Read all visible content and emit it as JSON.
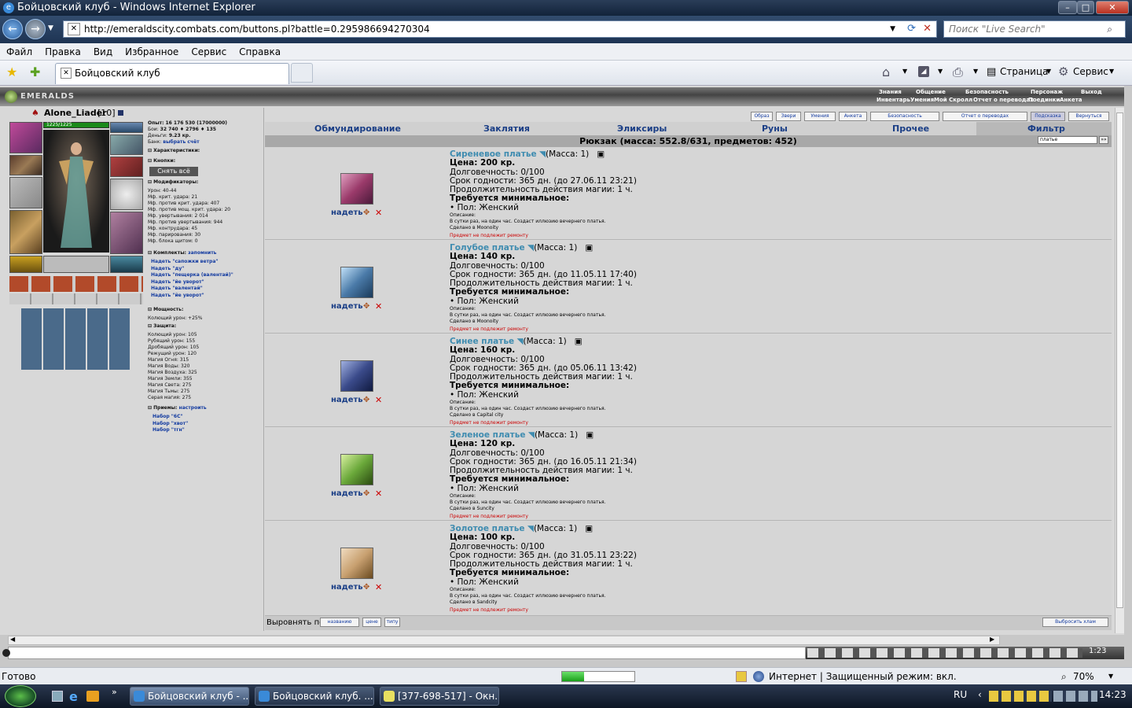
{
  "window": {
    "title": "Бойцовский клуб - Windows Internet Explorer"
  },
  "browser": {
    "url": "http://emeraldscity.combats.com/buttons.pl?battle=0.295986694270304",
    "search_placeholder": "Поиск \"Live Search\"",
    "menu": [
      "Файл",
      "Правка",
      "Вид",
      "Избранное",
      "Сервис",
      "Справка"
    ],
    "tab_title": "Бойцовский клуб",
    "toolbar": {
      "page": "Страница",
      "tools": "Сервис"
    }
  },
  "game": {
    "logo": "EMERALDS",
    "top_links_row1": [
      "Знания",
      "Общение",
      "Безопасность",
      "Персонаж",
      "Выход"
    ],
    "top_links_row2": [
      "Инвентарь",
      "Умения",
      "Мой Скролл",
      "Отчет о переводах",
      "Поединки",
      "Анкета"
    ],
    "right_buttons": [
      "Образ",
      "Звери",
      "Умения",
      "Анкета",
      "Безопасность",
      "Отчет о переводах",
      "Подсказка",
      "Вернуться"
    ],
    "character": {
      "name": "Alone_Liader",
      "level": "[10]",
      "hp": "1225/1225",
      "stats": [
        [
          "Опыт:",
          "16 176 530 (17000000)"
        ],
        [
          "Бои:",
          "32 740 ♦ 2796 ♦ 135"
        ],
        [
          "Деньги:",
          "9.23 кр."
        ],
        [
          "Банк:",
          "выбрать счёт"
        ]
      ],
      "sections": [
        "Характеристики:",
        "Кнопки:",
        "Модификаторы:",
        "Комплекты:",
        "Мощность:",
        "Защита:",
        "Приемы:"
      ],
      "remove_all": "Снять всё",
      "modifiers": [
        "Урон: 40-44",
        "Мф. крит. удара: 21",
        "Мф. против крит. удара: 407",
        "Мф. против мощ. крит. удара: 20",
        "Мф. увертывания: 2 014",
        "Мф. против увертывания: 944",
        "Мф. контрудара: 45",
        "Мф. парирования: 30",
        "Мф. блока щитом: 0"
      ],
      "sets_link": "запомнить",
      "sets": [
        "Надеть \"сапожки ветра\"",
        "Надеть \"ду\"",
        "Надеть \"пещерка (валентай)\"",
        "Надеть \"йе уворот\"",
        "Надеть \"валентай\"",
        "Надеть \"йе уворот\""
      ],
      "power": [
        "Колющий урон: +25%"
      ],
      "defense": [
        "Колющий урон: 105",
        "Рубящий урон: 155",
        "Дробящий урон: 105",
        "Режущий урон: 120",
        "Магия Огня: 315",
        "Магия Воды: 320",
        "Магия Воздуха: 325",
        "Магия Земли: 355",
        "Магия Света: 275",
        "Магия Тьмы: 275",
        "Серая магия: 275"
      ],
      "techniques_link": "настроить",
      "techniques": [
        "Набор \"6С\"",
        "Набор \"хвот\"",
        "Набор \"тгн\""
      ]
    },
    "inventory_tabs": [
      "Обмундирование",
      "Заклятия",
      "Эликсиры",
      "Руны",
      "Прочее",
      "Фильтр"
    ],
    "filter_value": "платье",
    "filter_button": "»»",
    "backpack": "Рюкзак (масса: 552.8/631, предметов: 452)",
    "wear_label": "надеть",
    "items": [
      {
        "name": "Сиреневое платье",
        "mass": "(Масса: 1)",
        "price": "Цена: 200 кр.",
        "durability": "Долговечность: 0/100",
        "expiry": "Срок годности: 365 дн. (до 27.06.11 23:21)",
        "duration": "Продолжительность действия магии: 1 ч.",
        "req": "Требуется минимальное:",
        "gender": "• Пол: Женский",
        "desc_label": "Описание:",
        "desc": "В сутки раз, на один час. Создаст иллюзию вечернего платья.",
        "made": "Сделано в Moonoity",
        "repair": "Предмет не подлежит ремонту",
        "color": "#9a3a6a"
      },
      {
        "name": "Голубое платье",
        "mass": "(Масса: 1)",
        "price": "Цена: 140 кр.",
        "durability": "Долговечность: 0/100",
        "expiry": "Срок годности: 365 дн. (до 11.05.11 17:40)",
        "duration": "Продолжительность действия магии: 1 ч.",
        "req": "Требуется минимальное:",
        "gender": "• Пол: Женский",
        "desc_label": "Описание:",
        "desc": "В сутки раз, на один час. Создаст иллюзию вечернего платья.",
        "made": "Сделано в Moonoity",
        "repair": "Предмет не подлежит ремонту",
        "color": "#4a7aa8"
      },
      {
        "name": "Синее платье",
        "mass": "(Масса: 1)",
        "price": "Цена: 160 кр.",
        "durability": "Долговечность: 0/100",
        "expiry": "Срок годности: 365 дн. (до 05.06.11 13:42)",
        "duration": "Продолжительность действия магии: 1 ч.",
        "req": "Требуется минимальное:",
        "gender": "• Пол: Женский",
        "desc_label": "Описание:",
        "desc": "В сутки раз, на один час. Создаст иллюзию вечернего платья.",
        "made": "Сделано в Capital city",
        "repair": "Предмет не подлежит ремонту",
        "color": "#3a4a8a"
      },
      {
        "name": "Зеленое платье",
        "mass": "(Масса: 1)",
        "price": "Цена: 120 кр.",
        "durability": "Долговечность: 0/100",
        "expiry": "Срок годности: 365 дн. (до 16.05.11 21:34)",
        "duration": "Продолжительность действия магии: 1 ч.",
        "req": "Требуется минимальное:",
        "gender": "• Пол: Женский",
        "desc_label": "Описание:",
        "desc": "В сутки раз, на один час. Создаст иллюзию вечернего платья.",
        "made": "Сделано в Suncity",
        "repair": "Предмет не подлежит ремонту",
        "color": "#6aa83a"
      },
      {
        "name": "Золотое платье",
        "mass": "(Масса: 1)",
        "price": "Цена: 100 кр.",
        "durability": "Долговечность: 0/100",
        "expiry": "Срок годности: 365 дн. (до 31.05.11 23:22)",
        "duration": "Продолжительность действия магии: 1 ч.",
        "req": "Требуется минимальное:",
        "gender": "• Пол: Женский",
        "desc_label": "Описание:",
        "desc": "В сутки раз, на один час. Создаст иллюзию вечернего платья.",
        "made": "Сделано в Sandcity",
        "repair": "Предмет не подлежит ремонту",
        "color": "#c8a070"
      }
    ],
    "sort_label": "Выровнять по",
    "sort_buttons": [
      "названию",
      "цене",
      "типу"
    ],
    "drop_all": "Выбросить хлам",
    "clock": "1:23"
  },
  "status": {
    "text": "Готово",
    "zone": "Интернет | Защищенный режим: вкл.",
    "zoom": "70%",
    "progress": 0.3
  },
  "taskbar": {
    "tasks": [
      "Бойцовский клуб - ...",
      "Бойцовский клуб. ...",
      "[377-698-517] - Окн..."
    ],
    "lang": "RU",
    "time": "14:23"
  }
}
